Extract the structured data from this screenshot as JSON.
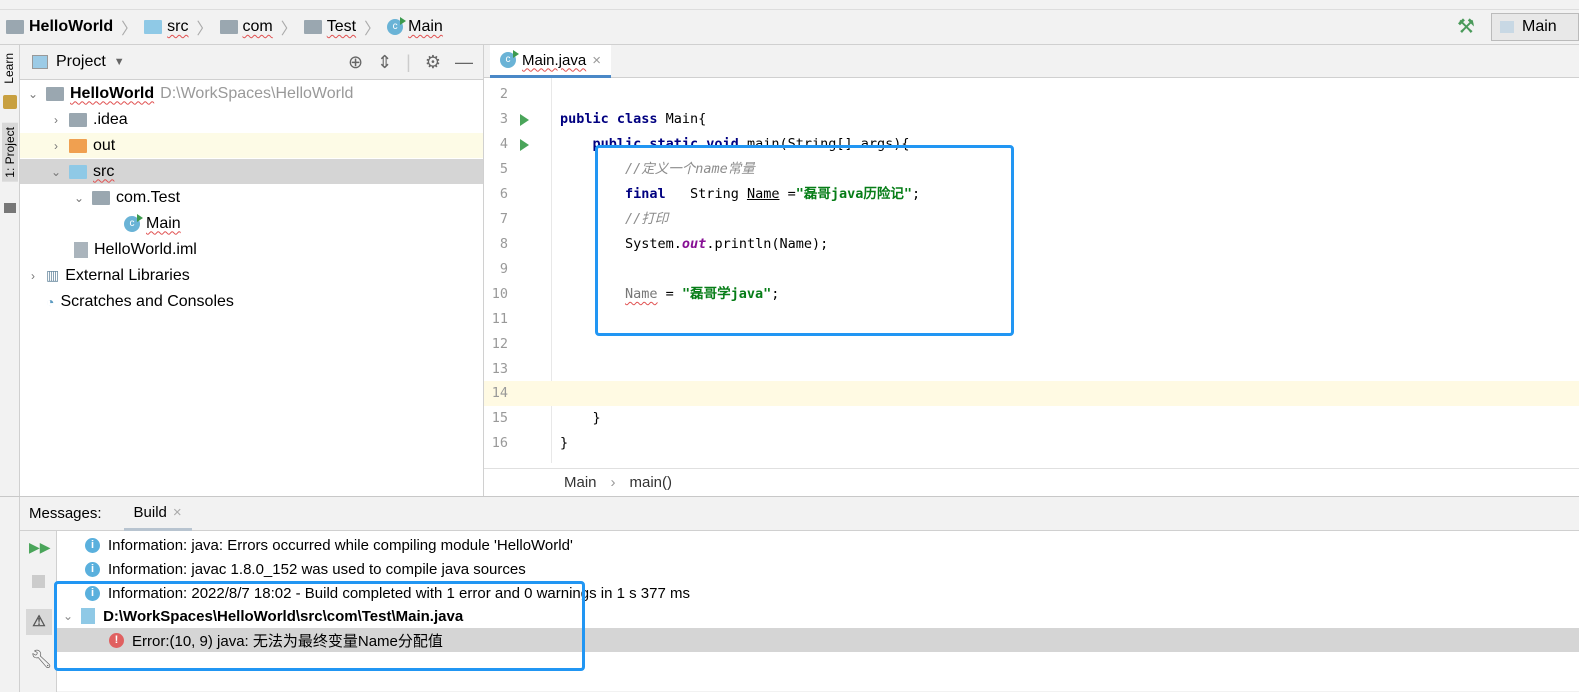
{
  "breadcrumb": [
    "HelloWorld",
    "src",
    "com",
    "Test",
    "Main"
  ],
  "run_config": "Main",
  "side_tabs": [
    "Learn",
    "1: Project"
  ],
  "project": {
    "title": "Project",
    "tree": [
      {
        "label": "HelloWorld",
        "path": "D:\\WorkSpaces\\HelloWorld",
        "depth": 0,
        "expanded": true,
        "icon": "module-folder"
      },
      {
        "label": ".idea",
        "depth": 1,
        "expanded": false,
        "icon": "folder"
      },
      {
        "label": "out",
        "depth": 1,
        "expanded": false,
        "icon": "folder-orange"
      },
      {
        "label": "src",
        "depth": 1,
        "expanded": true,
        "icon": "folder-blue",
        "selected": true
      },
      {
        "label": "com.Test",
        "depth": 2,
        "expanded": true,
        "icon": "package"
      },
      {
        "label": "Main",
        "depth": 3,
        "icon": "class"
      },
      {
        "label": "HelloWorld.iml",
        "depth": 1,
        "icon": "iml-file"
      },
      {
        "label": "External Libraries",
        "depth": 0,
        "expanded": false,
        "icon": "libraries"
      },
      {
        "label": "Scratches and Consoles",
        "depth": 0,
        "icon": "scratches"
      }
    ]
  },
  "editor": {
    "tab": "Main.java",
    "lines": [
      {
        "n": "2",
        "text": ""
      },
      {
        "n": "3",
        "text": "public class Main{"
      },
      {
        "n": "4",
        "text": "    public static void main(String[] args){"
      },
      {
        "n": "5",
        "text": "        //定义一个name常量"
      },
      {
        "n": "6",
        "text": "        final   String Name =\"磊哥java历险记\";"
      },
      {
        "n": "7",
        "text": "        //打印"
      },
      {
        "n": "8",
        "text": "        System.out.println(Name);"
      },
      {
        "n": "9",
        "text": ""
      },
      {
        "n": "10",
        "text": "        Name = \"磊哥学java\";"
      },
      {
        "n": "11",
        "text": ""
      },
      {
        "n": "12",
        "text": ""
      },
      {
        "n": "13",
        "text": ""
      },
      {
        "n": "14",
        "text": ""
      },
      {
        "n": "15",
        "text": "    }"
      },
      {
        "n": "16",
        "text": "}"
      }
    ],
    "crumbs": [
      "Main",
      "main()"
    ]
  },
  "messages": {
    "label": "Messages:",
    "tab": "Build",
    "items": [
      "Information: java: Errors occurred while compiling module 'HelloWorld'",
      "Information: javac 1.8.0_152 was used to compile java sources",
      "Information: 2022/8/7 18:02 - Build completed with 1 error and 0 warnings in 1 s 377 ms",
      "D:\\WorkSpaces\\HelloWorld\\src\\com\\Test\\Main.java",
      "Error:(10, 9)  java: 无法为最终变量Name分配值"
    ]
  },
  "colors": {
    "highlight_box": "#2196f3",
    "current_line": "#fffae3",
    "selection": "#d5d5d5"
  }
}
